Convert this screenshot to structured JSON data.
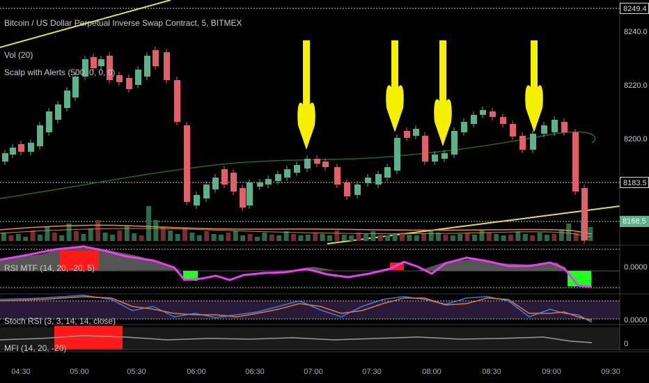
{
  "chart": {
    "title": "Bitcoin / US Dollar Perpetual Inverse Swap Contract, 5, BITMEX",
    "volume_label": "Vol (20)",
    "indicator_label": "Scalp with Alerts (500, 0, 0, 0)",
    "rsi_label": "RSI MTF (14, 20, -20, 5)",
    "stoch_label": "Stoch RSI (3, 3, 14, 14, close)",
    "mfi_label": "MFI (14, 20, -20)"
  },
  "price_axis": {
    "labels": [
      "8249.4",
      "8240.0",
      "8220.0",
      "8200.0",
      "8183.5",
      "8168.5"
    ],
    "current_price": "8168.5",
    "marked_price": "8183.5",
    "top_price": "8249.4"
  },
  "rsi_axis": {
    "label": "0.0000"
  },
  "stoch_axis": {
    "label": "0.0000"
  },
  "mfi_axis": {
    "label": "0"
  },
  "time_axis": {
    "labels": [
      "04:30",
      "05:00",
      "05:30",
      "06:00",
      "06:30",
      "07:00",
      "07:30",
      "08:00",
      "08:30",
      "09:00",
      "09:30"
    ]
  },
  "colors": {
    "up": "#5ab18a",
    "down": "#e0606a",
    "volume_up": "#2a6b4e",
    "volume_down": "#7a2a33",
    "ma_green": "#1f6b2a",
    "ma_orange": "#e69138",
    "trendline": "#e6e048",
    "arrow": "#f5f000",
    "rsi_line": "#e83ff0",
    "alert_red": "#ff1a1a",
    "alert_green": "#22ff22"
  },
  "arrows": {
    "count": 4,
    "icon": "arrow-down-icon"
  }
}
